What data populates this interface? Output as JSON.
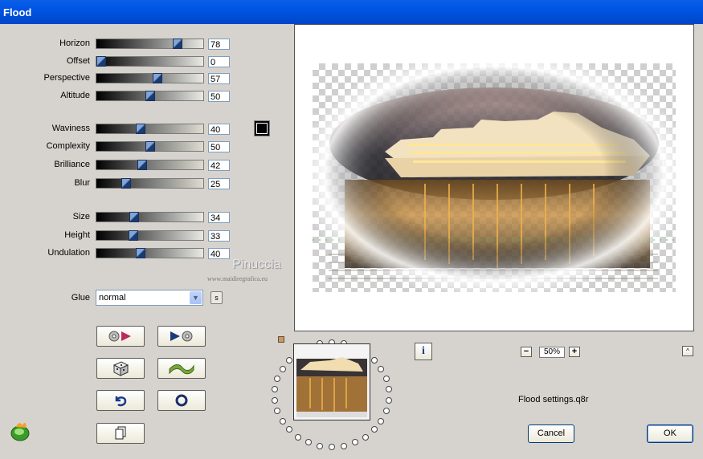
{
  "window": {
    "title": "Flood"
  },
  "params": [
    {
      "id": "horizon",
      "label": "Horizon",
      "value": "78",
      "fraction": 0.78
    },
    {
      "id": "offset",
      "label": "Offset",
      "value": "0",
      "fraction": 0.0
    },
    {
      "id": "perspective",
      "label": "Perspective",
      "value": "57",
      "fraction": 0.57
    },
    {
      "id": "altitude",
      "label": "Altitude",
      "value": "50",
      "fraction": 0.5
    },
    {
      "id": "waviness",
      "label": "Waviness",
      "value": "40",
      "fraction": 0.4
    },
    {
      "id": "complexity",
      "label": "Complexity",
      "value": "50",
      "fraction": 0.5
    },
    {
      "id": "brilliance",
      "label": "Brilliance",
      "value": "42",
      "fraction": 0.42
    },
    {
      "id": "blur",
      "label": "Blur",
      "value": "25",
      "fraction": 0.25
    },
    {
      "id": "size",
      "label": "Size",
      "value": "34",
      "fraction": 0.34
    },
    {
      "id": "height",
      "label": "Height",
      "value": "33",
      "fraction": 0.33
    },
    {
      "id": "undulation",
      "label": "Undulation",
      "value": "40",
      "fraction": 0.4
    }
  ],
  "glue": {
    "label": "Glue",
    "value": "normal",
    "s_button": "s"
  },
  "color_swatch": "#000000",
  "watermark": {
    "name": "Pinuccia",
    "url": "www.maidiregrafica.eu"
  },
  "zoom": {
    "value": "50%",
    "minus": "−",
    "plus": "+"
  },
  "info_button": "i",
  "up_button": "^",
  "settings_file": "Flood settings.q8r",
  "buttons": {
    "cancel": "Cancel",
    "ok": "OK"
  },
  "icons": {
    "load_preset": "load-preset-icon",
    "save_preset": "save-preset-icon",
    "randomize": "dice-icon",
    "wave": "wave-icon",
    "undo": "undo-icon",
    "reset": "reset-icon",
    "copy": "copy-icon",
    "logo": "filter-factory-logo-icon"
  }
}
